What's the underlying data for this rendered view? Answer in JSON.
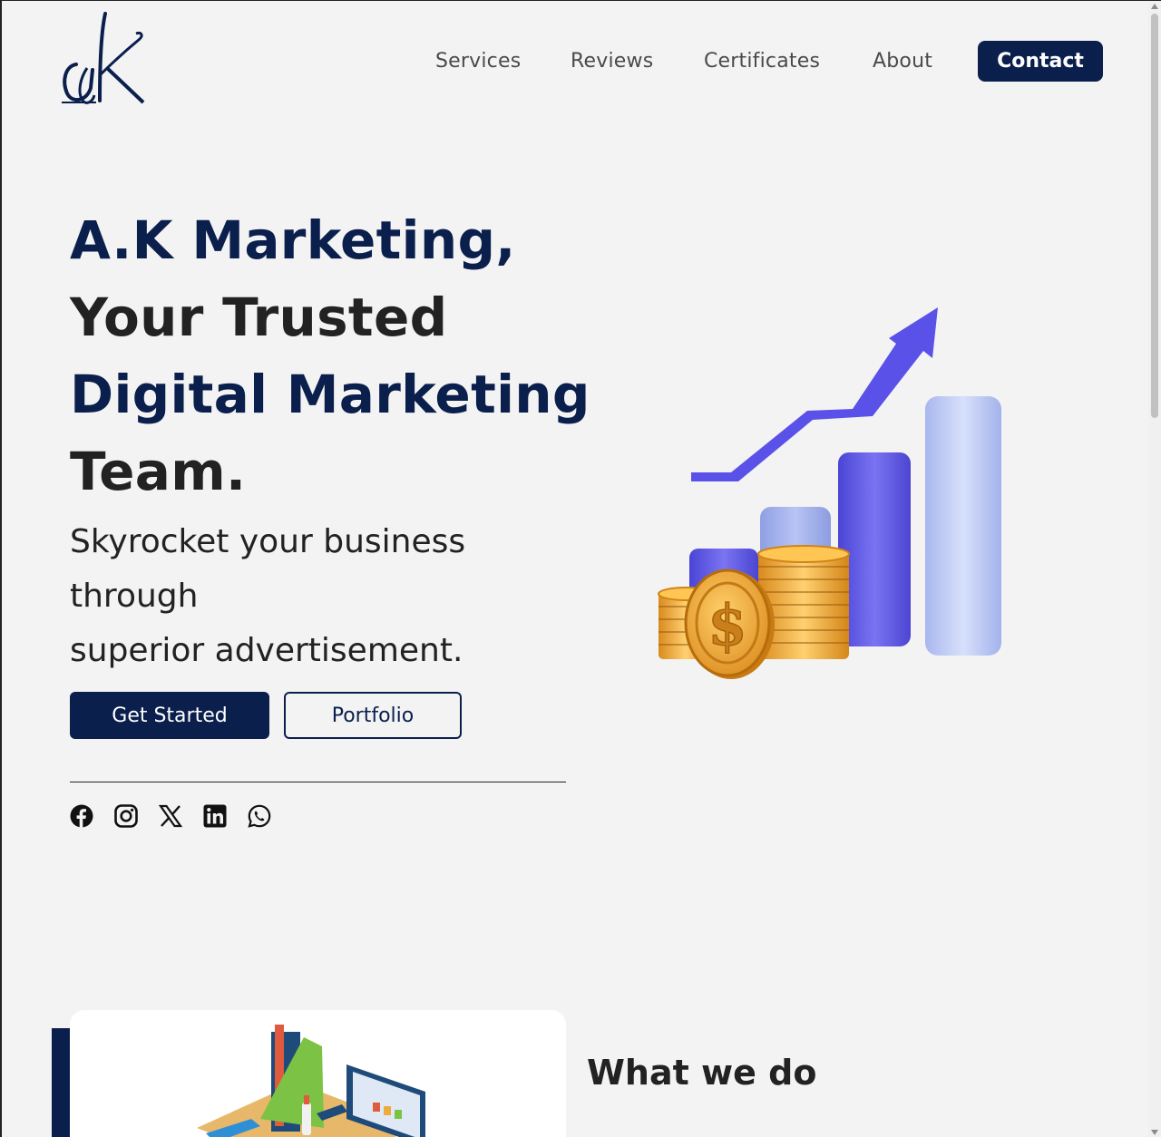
{
  "header": {
    "logo_alt": "aK",
    "nav": [
      {
        "label": "Services"
      },
      {
        "label": "Reviews"
      },
      {
        "label": "Certificates"
      },
      {
        "label": "About"
      }
    ],
    "contact_label": "Contact"
  },
  "hero": {
    "title_line1": "A.K Marketing,",
    "title_line2": "Your Trusted",
    "title_line3": "Digital Marketing",
    "title_line4": "Team.",
    "subtitle_line1": "Skyrocket your business",
    "subtitle_line2": "through",
    "subtitle_line3": "superior advertisement.",
    "primary_button": "Get Started",
    "secondary_button": "Portfolio"
  },
  "socials": [
    "facebook-icon",
    "instagram-icon",
    "x-icon",
    "linkedin-icon",
    "whatsapp-icon"
  ],
  "what_we_do": {
    "title": "What we do"
  },
  "colors": {
    "navy": "#0b1f4d",
    "background": "#f3f3f3",
    "text_dark": "#222222",
    "nav_text": "#4a4a4a",
    "bar_purple": "#5b55e6",
    "bar_light": "#b9c7f2",
    "coin_gold": "#f2a93b"
  }
}
